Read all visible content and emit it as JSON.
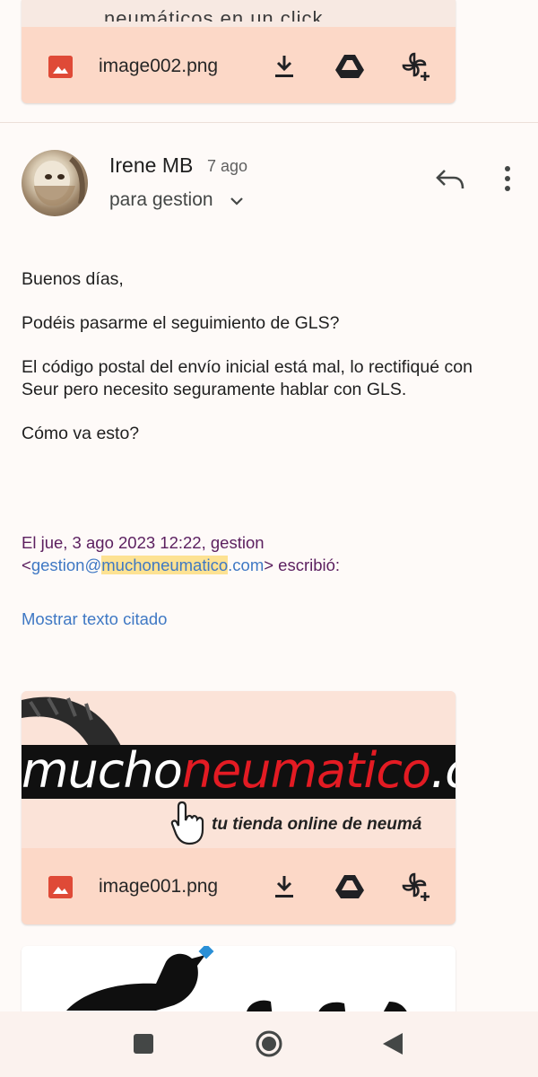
{
  "top_attachment": {
    "filename": "image002.png",
    "cut_text": "neumáticos en un click"
  },
  "message": {
    "sender": "Irene MB",
    "time": "7 ago",
    "recipient": "para gestion",
    "body": [
      "Buenos días,",
      "Podéis pasarme el seguimiento de GLS?",
      "El código postal del envío inicial está mal, lo rectifiqué con",
      "Seur pero necesito seguramente hablar con GLS.",
      "Cómo va esto?"
    ],
    "quote_header": {
      "line1": "El jue, 3 ago 2023 12:22, gestion",
      "lt": "<",
      "email_user": "gestion@",
      "email_highlight": "muchoneumatico",
      "email_tld": ".com",
      "gt_wrote": "> escribió:"
    },
    "show_quoted": "Mostrar texto citado"
  },
  "bottom_attachment": {
    "filename": "image001.png",
    "logo_part1": "mucho",
    "logo_part2": "neumatico",
    "logo_part3": ".co",
    "tagline": "tu tienda online de neumá"
  },
  "icons": {
    "image": "image-icon",
    "download": "download-icon",
    "drive": "drive-icon",
    "photos_add": "photos-add-icon",
    "reply": "reply-icon",
    "more": "more-vert-icon",
    "chevron": "chevron-down-icon"
  },
  "colors": {
    "attachment_bg": "#fcd8c7",
    "link": "#3f78c4",
    "quote_header": "#5b1f5f",
    "highlight": "#fde293",
    "image_icon": "#df4a37"
  }
}
